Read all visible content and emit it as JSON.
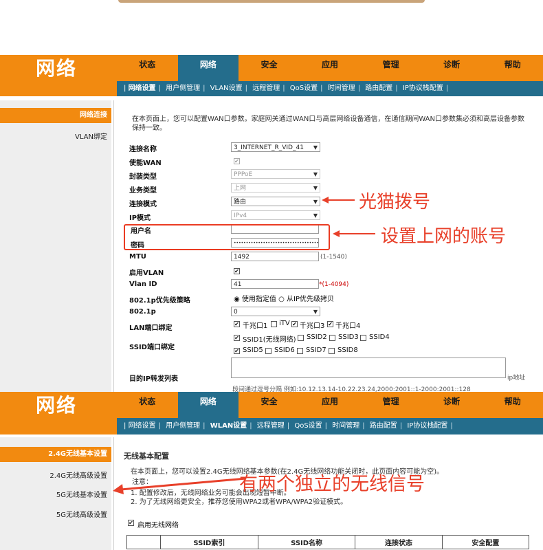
{
  "panel1": {
    "logo": "网络",
    "tabs": [
      "状态",
      "网络",
      "安全",
      "应用",
      "管理",
      "诊断",
      "帮助"
    ],
    "subnav": [
      "网络设置",
      "用户侧管理",
      "VLAN设置",
      "远程管理",
      "QoS设置",
      "时间管理",
      "路由配置",
      "IP协议栈配置"
    ],
    "leftnav": {
      "active": "网络连接",
      "items": [
        "VLAN绑定"
      ]
    },
    "description": "在本页面上，您可以配置WAN口参数。家庭网关通过WAN口与高层网络设备通信，在通信期间WAN口参数集必须和高层设备参数保持一致。",
    "form": {
      "conn_name_label": "连接名称",
      "conn_name_value": "3_INTERNET_R_VID_41",
      "enable_wan_label": "使能WAN",
      "encap_label": "封装类型",
      "encap_value": "PPPoE",
      "service_label": "业务类型",
      "service_value": "上网",
      "mode_label": "连接模式",
      "mode_value": "路由",
      "ipmode_label": "IP模式",
      "ipmode_value": "IPv4",
      "user_label": "用户名",
      "pass_label": "密码",
      "pass_value": "••••••••••••••••••••••••••••••••••••••",
      "mtu_label": "MTU",
      "mtu_value": "1492",
      "mtu_hint": "(1-1540)",
      "vlan_en_label": "启用VLAN",
      "vlanid_label": "Vlan ID",
      "vlanid_value": "41",
      "vlanid_hint": "*(1-4094)",
      "prio_label": "802.1p优先级策略",
      "prio_opt1": "使用指定值",
      "prio_opt2": "从IP优先级拷贝",
      "dot1p_label": "802.1p",
      "dot1p_value": "0",
      "lan_label": "LAN端口绑定",
      "lan1": "千兆口1",
      "itv": "iTV",
      "lan3": "千兆口3",
      "lan4": "千兆口4",
      "ssid_label": "SSID端口绑定",
      "ssid1": "SSID1(无线网络)",
      "ssid2": "SSID2",
      "ssid3": "SSID3",
      "ssid4": "SSID4",
      "ssid5": "SSID5",
      "ssid6": "SSID6",
      "ssid7": "SSID7",
      "ssid8": "SSID8",
      "dest_label": "目的IP转发列表",
      "dest_suffix": "ip地址",
      "dest_hint": "段间通过逗号分隔 例如:10.12.13.14-10.22.23.24,2000:2001::1-2000:2001::128"
    },
    "annotations": {
      "a1": "光猫拨号",
      "a2": "设置上网的账号"
    }
  },
  "panel2": {
    "logo": "网络",
    "tabs": [
      "状态",
      "网络",
      "安全",
      "应用",
      "管理",
      "诊断",
      "帮助"
    ],
    "subnav": [
      "网络设置",
      "用户侧管理",
      "WLAN设置",
      "远程管理",
      "QoS设置",
      "时间管理",
      "路由配置",
      "IP协议栈配置"
    ],
    "leftnav": {
      "active": "2.4G无线基本设置",
      "items": [
        "2.4G无线高级设置",
        "5G无线基本设置",
        "5G无线高级设置"
      ]
    },
    "section_title": "无线基本配置",
    "desc1": "在本页面上，您可以设置2.4G无线网络基本参数(在2.4G无线网络功能关闭时，此页面内容可能为空)。",
    "note_title": "注意：",
    "note1": "1. 配置修改后，无线网络业务可能会出现短暂中断。",
    "note2": "2. 为了无线网络更安全，推荐您使用WPA2或者WPA/WPA2验证模式。",
    "enable_wifi": "启用无线网络",
    "table_headers": [
      "SSID索引",
      "SSID名称",
      "连接状态",
      "安全配置"
    ],
    "annotation": "有两个独立的无线信号"
  },
  "colors": {
    "orange": "#f28a10",
    "teal": "#246d8c",
    "annot_red": "#e8402a"
  }
}
